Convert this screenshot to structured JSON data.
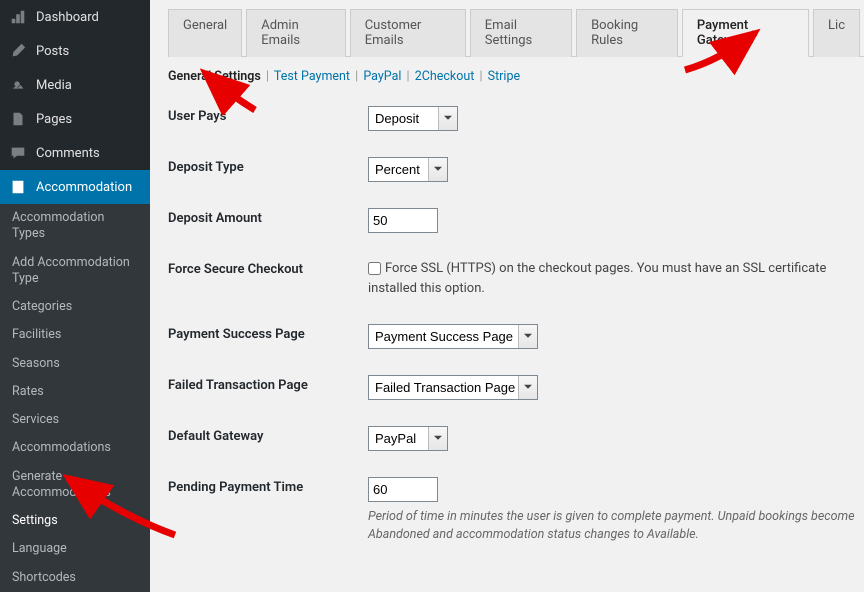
{
  "sidebar": {
    "items": [
      {
        "icon": "dashboard",
        "label": "Dashboard"
      },
      {
        "icon": "pin",
        "label": "Posts"
      },
      {
        "icon": "media",
        "label": "Media"
      },
      {
        "icon": "page",
        "label": "Pages"
      },
      {
        "icon": "comment",
        "label": "Comments"
      },
      {
        "icon": "building",
        "label": "Accommodation"
      }
    ],
    "submenu": [
      "Accommodation Types",
      "Add Accommodation Type",
      "Categories",
      "Facilities",
      "Seasons",
      "Rates",
      "Services",
      "Accommodations",
      "Generate Accommodations",
      "Settings",
      "Language",
      "Shortcodes"
    ]
  },
  "tabs": [
    "General",
    "Admin Emails",
    "Customer Emails",
    "Email Settings",
    "Booking Rules",
    "Payment Gateways",
    "Lic"
  ],
  "active_tab": "Payment Gateways",
  "subnav": [
    "General Settings",
    "Test Payment",
    "PayPal",
    "2Checkout",
    "Stripe"
  ],
  "subnav_active": "General Settings",
  "fields": {
    "user_pays": {
      "label": "User Pays",
      "value": "Deposit"
    },
    "deposit_type": {
      "label": "Deposit Type",
      "value": "Percent"
    },
    "deposit_amount": {
      "label": "Deposit Amount",
      "value": "50"
    },
    "force_ssl": {
      "label": "Force Secure Checkout",
      "checked": false,
      "text": "Force SSL (HTTPS) on the checkout pages. You must have an SSL certificate installed this option."
    },
    "success_page": {
      "label": "Payment Success Page",
      "value": "Payment Success Page"
    },
    "failed_page": {
      "label": "Failed Transaction Page",
      "value": "Failed Transaction Page"
    },
    "default_gateway": {
      "label": "Default Gateway",
      "value": "PayPal"
    },
    "pending_time": {
      "label": "Pending Payment Time",
      "value": "60",
      "desc": "Period of time in minutes the user is given to complete payment. Unpaid bookings become Abandoned and accommodation status changes to Available."
    }
  }
}
